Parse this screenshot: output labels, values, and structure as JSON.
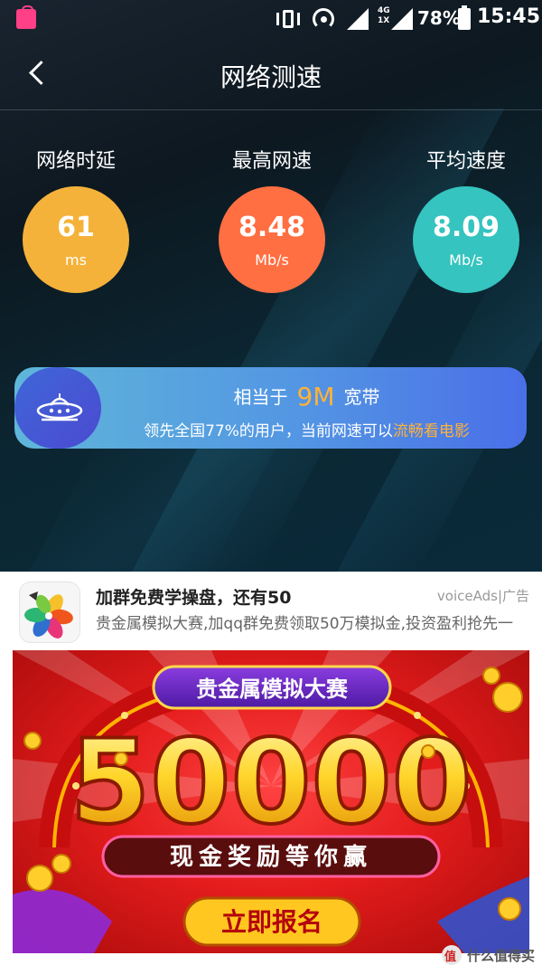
{
  "status_bar": {
    "network_type_top": "4G",
    "network_type_bottom": "1X",
    "battery": "78%",
    "time": "15:45"
  },
  "header": {
    "title": "网络测速"
  },
  "metrics": [
    {
      "label": "网络时延",
      "value": "61",
      "unit": "ms",
      "color": "#f4b23a"
    },
    {
      "label": "最高网速",
      "value": "8.48",
      "unit": "Mb/s",
      "color": "#ff6f42"
    },
    {
      "label": "平均速度",
      "value": "8.09",
      "unit": "Mb/s",
      "color": "#35c4bf"
    }
  ],
  "banner": {
    "prefix": "相当于",
    "bandwidth": "9M",
    "suffix": "宽带",
    "line2_main": "领先全国77%的用户，当前网速可以",
    "line2_highlight": "流畅看电影"
  },
  "ad": {
    "title": "加群免费学操盘，还有50",
    "source": "voiceAds|广告",
    "description": "贵金属模拟大赛,加qq群免费领取50万模拟金,投资盈利抢先一",
    "image": {
      "headline": "贵金属模拟大赛",
      "amount": "50000",
      "subline": "现金奖励等你赢",
      "cta": "立即报名"
    }
  },
  "watermark": "什么值得买",
  "colors": {
    "accent_orange": "#ffb238",
    "banner_blue": "#5396e3",
    "ad_red": "#e41c1c"
  }
}
